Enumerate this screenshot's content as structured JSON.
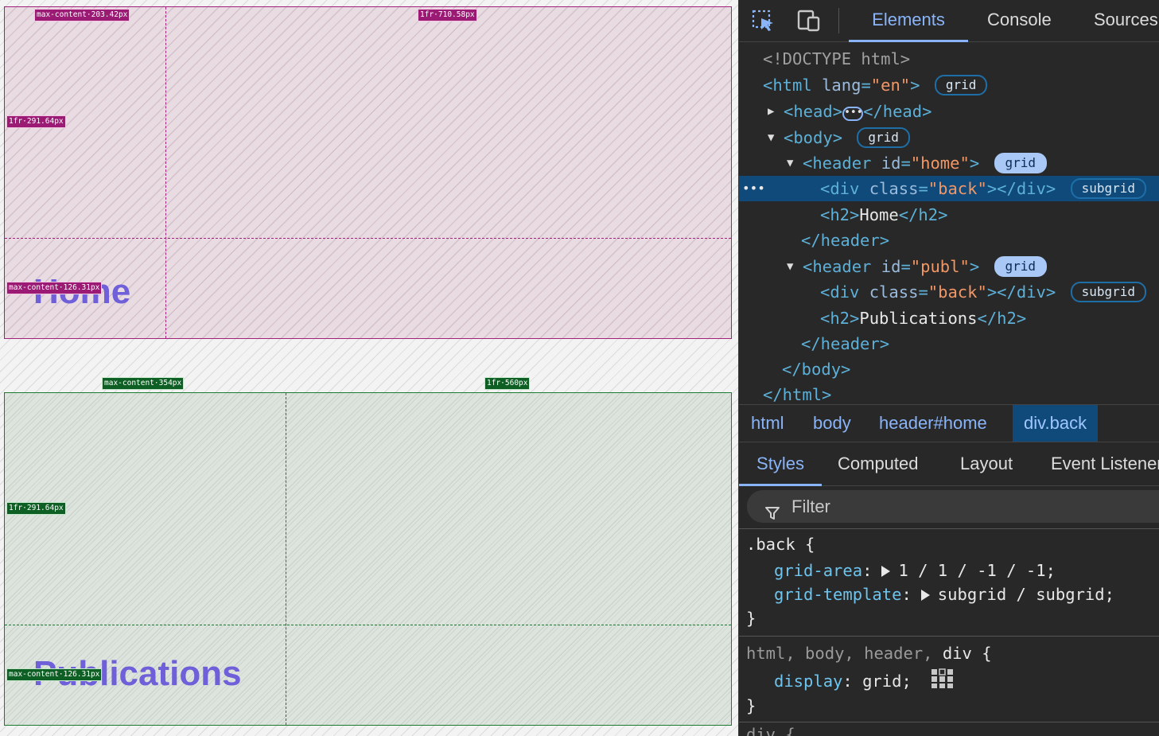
{
  "viewport": {
    "home": {
      "heading": "Home",
      "col_tags": [
        "max-content·203.42px",
        "1fr·710.58px"
      ],
      "row_tags": [
        "1fr·291.64px",
        "max-content·126.31px"
      ],
      "color": "#a0207a"
    },
    "publ": {
      "heading": "Publications",
      "col_tags": [
        "max-content·354px",
        "1fr·560px"
      ],
      "row_tags": [
        "1fr·291.64px",
        "max-content·126.31px"
      ],
      "color": "#1a7a30"
    }
  },
  "devtools": {
    "tabs": [
      "Elements",
      "Console",
      "Sources"
    ],
    "active_tab": "Elements",
    "dom": {
      "doctype": "<!DOCTYPE html>",
      "html_open_tag": "<html",
      "attr_lang": "lang",
      "attr_lang_val": "\"en\"",
      "badge_grid": "grid",
      "badge_subgrid": "subgrid",
      "head_open": "<head>",
      "head_close": "</head>",
      "body_open": "<body>",
      "header_open": "<header",
      "attr_id": "id",
      "id_home": "\"home\"",
      "id_publ": "\"publ\"",
      "div_open": "<div",
      "attr_class": "class",
      "class_back": "\"back\"",
      "div_close": "></div>",
      "h2_open": "<h2>",
      "h2_close": "</h2>",
      "h2_home": "Home",
      "h2_publ": "Publications",
      "header_close": "</header>",
      "body_close": "</body>",
      "html_close": "</html>",
      "eq": "=",
      "gt": ">"
    },
    "breadcrumbs": [
      "html",
      "body",
      "header#home",
      "div.back"
    ],
    "styles_tabs": [
      "Styles",
      "Computed",
      "Layout",
      "Event Listeners"
    ],
    "filter_placeholder": "Filter",
    "rules": {
      "back_selector": ".back {",
      "grid_area_prop": "grid-area",
      "grid_area_val": "1 / 1 / -1 / -1;",
      "grid_template_prop": "grid-template",
      "grid_template_val": "subgrid / subgrid;",
      "close_brace": "}",
      "sel2_dim": "html, body, header,",
      "sel2_div": "div",
      "sel2_brace": "{",
      "display_prop": "display",
      "display_val": "grid;",
      "next_rule_partial": "div {"
    },
    "colors": {
      "accent": "#8ab4f8",
      "selection": "#0f4a7a",
      "tag": "#5db0d7",
      "attr_value": "#f29766"
    }
  }
}
